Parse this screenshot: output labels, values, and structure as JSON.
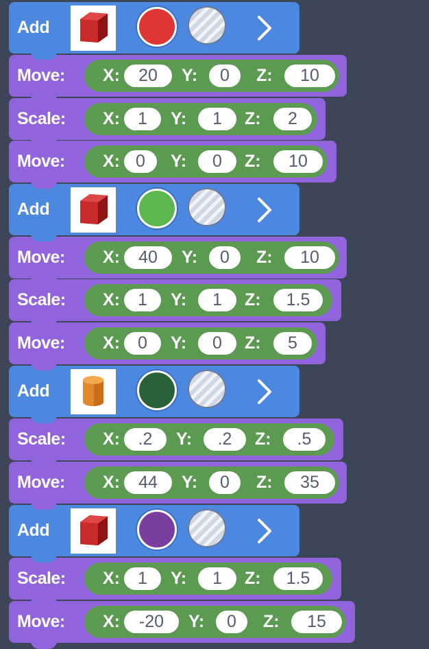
{
  "labels": {
    "add": "Add",
    "move": "Move:",
    "scale": "Scale:"
  },
  "axes": {
    "x": "X:",
    "y": "Y:",
    "z": "Z:"
  },
  "icons": {
    "cube": "red-cube-icon",
    "cylinder": "orange-cylinder-icon",
    "texture": "striped-texture-icon",
    "next": "chevron-right-icon"
  },
  "blocks": [
    {
      "kind": "add",
      "shape": "cube",
      "color": "#e03535"
    },
    {
      "kind": "move",
      "x": "20",
      "y": "0",
      "z": "10"
    },
    {
      "kind": "scale",
      "x": "1",
      "y": "1",
      "z": "2"
    },
    {
      "kind": "move",
      "x": "0",
      "y": "0",
      "z": "10"
    },
    {
      "kind": "add",
      "shape": "cube",
      "color": "#5cb84e"
    },
    {
      "kind": "move",
      "x": "40",
      "y": "0",
      "z": "10"
    },
    {
      "kind": "scale",
      "x": "1",
      "y": "1",
      "z": "1.5"
    },
    {
      "kind": "move",
      "x": "0",
      "y": "0",
      "z": "5"
    },
    {
      "kind": "add",
      "shape": "cylinder",
      "color": "#2a6138"
    },
    {
      "kind": "scale",
      "x": ".2",
      "y": ".2",
      "z": ".5"
    },
    {
      "kind": "move",
      "x": "44",
      "y": "0",
      "z": "35"
    },
    {
      "kind": "add",
      "shape": "cube",
      "color": "#7a3f9e"
    },
    {
      "kind": "scale",
      "x": "1",
      "y": "1",
      "z": "1.5"
    },
    {
      "kind": "move",
      "x": "-20",
      "y": "0",
      "z": "15"
    }
  ]
}
